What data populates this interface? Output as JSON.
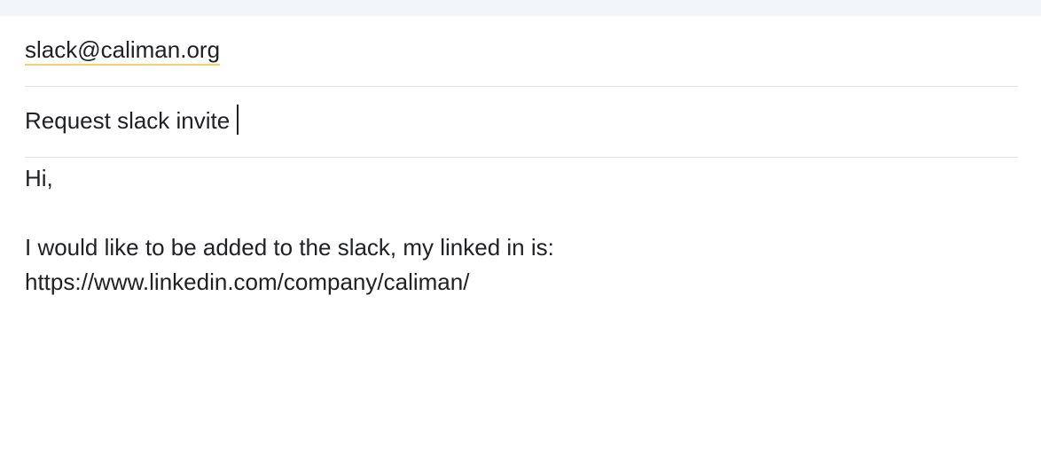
{
  "compose": {
    "to": {
      "recipient": "slack@caliman.org"
    },
    "subject": {
      "value": "Request slack invite"
    },
    "body": {
      "lines": [
        "Hi,",
        "",
        "I would like to be added to the slack, my linked in is:",
        "https://www.linkedin.com/company/caliman/"
      ]
    }
  },
  "colors": {
    "top_strip": "#f2f5f9",
    "recipient_underline": "#f2d26b",
    "divider": "#e6e6e6",
    "text": "#202124"
  }
}
